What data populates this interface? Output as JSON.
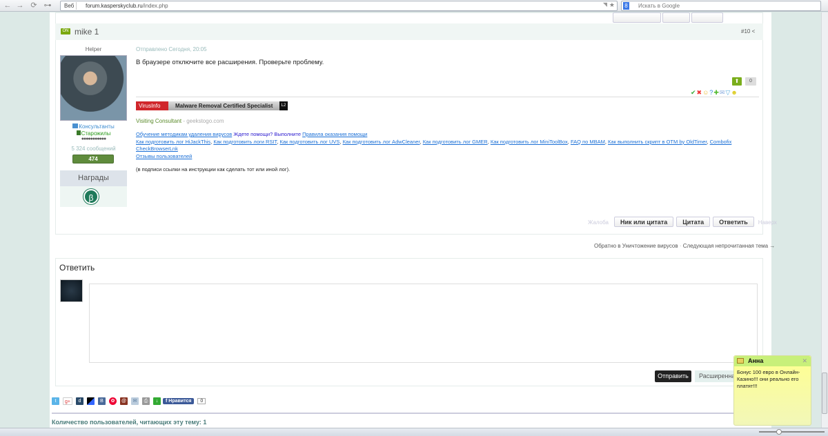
{
  "browser": {
    "back": "←",
    "forward": "→",
    "reload": "⟳",
    "key": "⊶",
    "badge": "Веб",
    "url_host": "forum.kasperskyclub.ru",
    "url_path": "/index.php",
    "rss": "◥",
    "star": "★",
    "search_engine": "8",
    "search_placeholder": "Искать в Google"
  },
  "post": {
    "status": "ON",
    "author": "mike 1",
    "number": "#10",
    "share": "<",
    "role": "Helper",
    "groups": [
      "Консультанты",
      "Старожилы"
    ],
    "stars": "●●●●●●●●●●●",
    "messages": "5 324 сообщений",
    "reputation": "474",
    "awards_title": "Награды",
    "award_symbol": "β",
    "posted": "Отправлено Сегодня, 20:05",
    "text": "В браузере отключите все расширения. Проверьте проблему.",
    "vote_up": "⬆",
    "vote_count": "0",
    "signature": {
      "banner_brand": "VirusInfo",
      "banner_text": "Malware Removal Certified Specialist",
      "banner_level": "L2",
      "visiting": "Visiting Consultant",
      "visiting_site": " - geekstogo.com",
      "line1_link": "Обучение методикам удаления вирусов",
      "line1_text": " Ждете помощи? Выполните ",
      "line1_link2": "Правила оказания помощи",
      "links": [
        "Как подготовить лог HiJackThis",
        "Как подготовить логи RSIT",
        "Как подготовить лог UVS",
        "Как подготовить лог AdwCleaner",
        "Как подготовить лог GMER",
        "Как подготовить лог MiniToolBox",
        "FAQ по MBAM",
        "Как выполнить скрипт в OTM by OldTimer",
        "Combofix"
      ],
      "link_cbl": "CheckBrowserLnk",
      "link_reviews": "Отзывы пользователей",
      "note": "(в подписи ссылки на инструкции как сделать тот или иной лог)."
    },
    "actions": {
      "report": "Жалоба",
      "nick_quote": "Ник или цитата",
      "quote": "Цитата",
      "reply": "Ответить",
      "top": "Наверх"
    }
  },
  "nav": {
    "back_link": "Обратно в Уничтожение вирусов",
    "sep": " · ",
    "next_link": "Следующая непрочитанная тема →"
  },
  "reply": {
    "title": "Ответить",
    "send": "Отправить",
    "advanced": "Расширенная"
  },
  "share": {
    "like": "f Нравится",
    "like_count": "0"
  },
  "readers": "Количество пользователей, читающих эту тему: 1",
  "popup": {
    "name": "Анна",
    "close": "✕",
    "text": "Бонус 100 евро в Онлайн-Казино!!! они реально его платят!!!"
  }
}
